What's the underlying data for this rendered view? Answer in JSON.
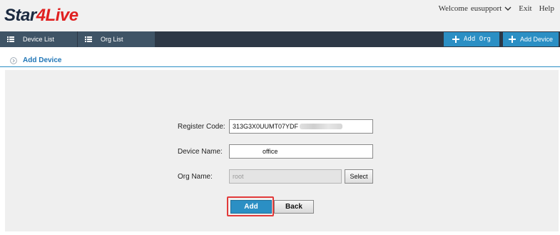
{
  "header": {
    "logo_part1": "Star",
    "logo_part2": "4Live",
    "welcome": "Welcome",
    "username": "eusupport",
    "exit": "Exit",
    "help": "Help"
  },
  "nav": {
    "tabs": [
      {
        "label": "Device List",
        "icon": "list-icon"
      },
      {
        "label": "Org List",
        "icon": "list-icon"
      }
    ],
    "add_org": "Add Org",
    "add_device": "Add Device"
  },
  "section": {
    "title": "Add Device"
  },
  "form": {
    "register_code_label": "Register Code:",
    "register_code_value": "313G3X0UUMT07YDF",
    "device_name_label": "Device Name:",
    "device_name_value": "office",
    "org_name_label": "Org Name:",
    "org_name_value": "root",
    "select_label": "Select",
    "add_label": "Add",
    "back_label": "Back"
  },
  "colors": {
    "nav_bg": "#2d3846",
    "tab_bg": "#3f5466",
    "accent": "#2b8fc4",
    "title_blue": "#2076b7",
    "logo_red": "#e02020",
    "highlight": "#e23a3a"
  }
}
